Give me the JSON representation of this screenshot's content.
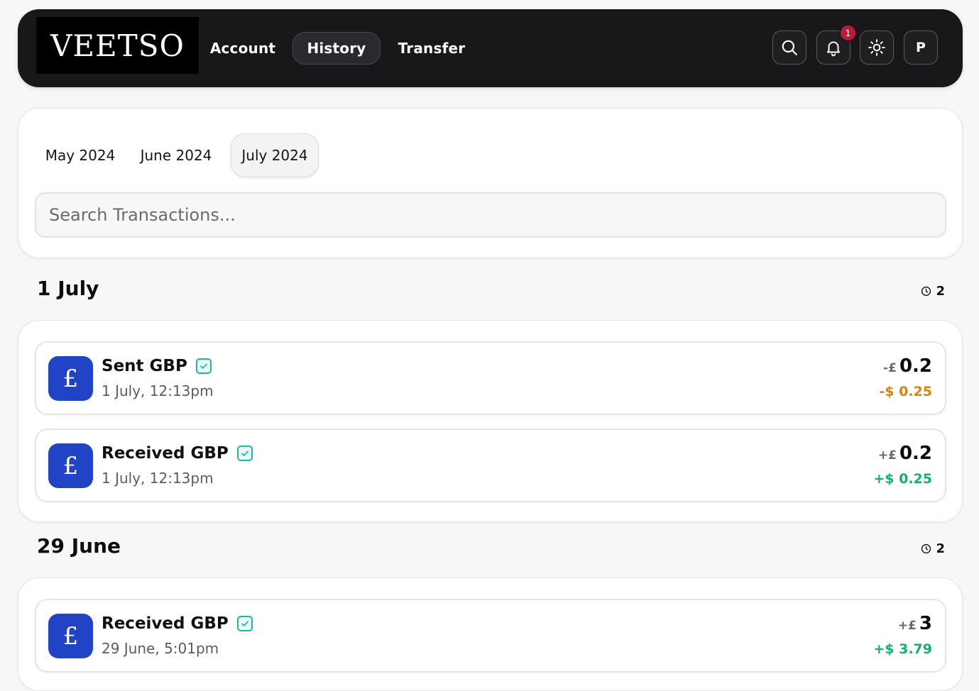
{
  "nav": {
    "logo": "VEETSO",
    "tabs": [
      "Account",
      "History",
      "Transfer"
    ],
    "active_tab": "History",
    "notification_count": "1",
    "profile_initial": "P"
  },
  "filter": {
    "months": [
      "May 2024",
      "June 2024",
      "July 2024"
    ],
    "selected_month": "July 2024",
    "search_placeholder": "Search Transactions..."
  },
  "groups": [
    {
      "date": "1 July",
      "count": "2",
      "transactions": [
        {
          "title": "Sent GBP",
          "time": "1 July, 12:13pm",
          "primary_prefix": "-£",
          "primary_value": "0.2",
          "secondary": "-$ 0.25",
          "direction": "sent"
        },
        {
          "title": "Received GBP",
          "time": "1 July, 12:13pm",
          "primary_prefix": "+£",
          "primary_value": "0.2",
          "secondary": "+$ 0.25",
          "direction": "received"
        }
      ]
    },
    {
      "date": "29 June",
      "count": "2",
      "transactions": [
        {
          "title": "Received GBP",
          "time": "29 June, 5:01pm",
          "primary_prefix": "+£",
          "primary_value": "3",
          "secondary": "+$ 3.79",
          "direction": "received"
        }
      ]
    }
  ],
  "colors": {
    "nav_bg": "#18181a",
    "currency_icon": "#2143c5",
    "negative": "#d98410",
    "positive": "#16b073",
    "verified": "#1fb89a",
    "badge": "#c0183a"
  },
  "icons": [
    "search-icon",
    "bell-icon",
    "sun-icon",
    "clock-icon",
    "verified-check-icon",
    "pound-icon"
  ]
}
